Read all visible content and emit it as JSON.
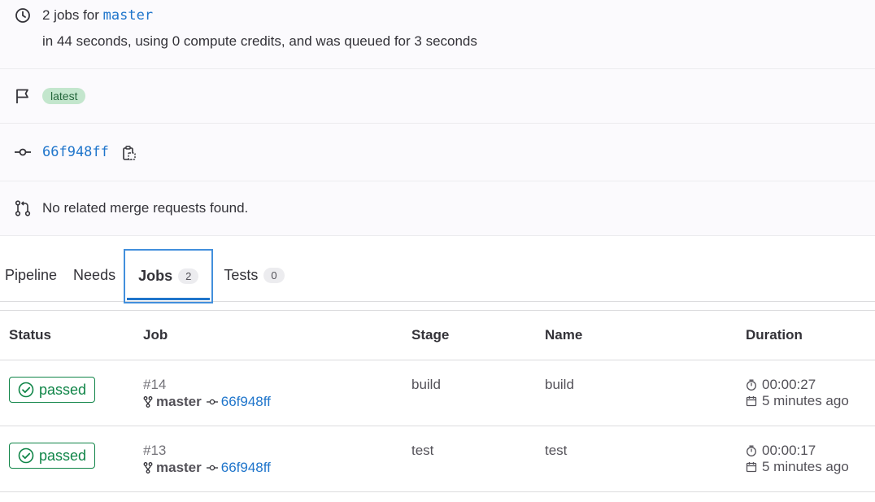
{
  "pipeline_info": {
    "jobs_summary_prefix": "2 jobs for",
    "branch": "master",
    "timing": "in 44 seconds, using 0 compute credits, and was queued for 3 seconds",
    "tag": "latest",
    "commit_sha": "66f948ff",
    "merge_requests": "No related merge requests found."
  },
  "tabs": [
    {
      "label": "Pipeline"
    },
    {
      "label": "Needs"
    },
    {
      "label": "Jobs",
      "count": "2"
    },
    {
      "label": "Tests",
      "count": "0"
    }
  ],
  "jobs_table": {
    "headers": [
      "Status",
      "Job",
      "Stage",
      "Name",
      "Duration"
    ],
    "rows": [
      {
        "status": "passed",
        "job_id": "#14",
        "branch": "master",
        "commit": "66f948ff",
        "stage": "build",
        "name": "build",
        "duration": "00:00:27",
        "finished": "5 minutes ago"
      },
      {
        "status": "passed",
        "job_id": "#13",
        "branch": "master",
        "commit": "66f948ff",
        "stage": "test",
        "name": "test",
        "duration": "00:00:17",
        "finished": "5 minutes ago"
      }
    ]
  },
  "icons": {
    "clock": "clock-icon",
    "flag": "flag-icon",
    "commit": "commit-icon",
    "merge_request": "merge-request-icon",
    "copy": "copy-to-clipboard-icon",
    "status_passed": "status-success-icon",
    "branch": "branch-icon",
    "timer": "timer-icon",
    "calendar": "calendar-icon"
  },
  "colors": {
    "link": "#1f75cb",
    "success": "#108548",
    "tag_bg": "#c3e6cd",
    "tab_focus": "#428fdc"
  }
}
